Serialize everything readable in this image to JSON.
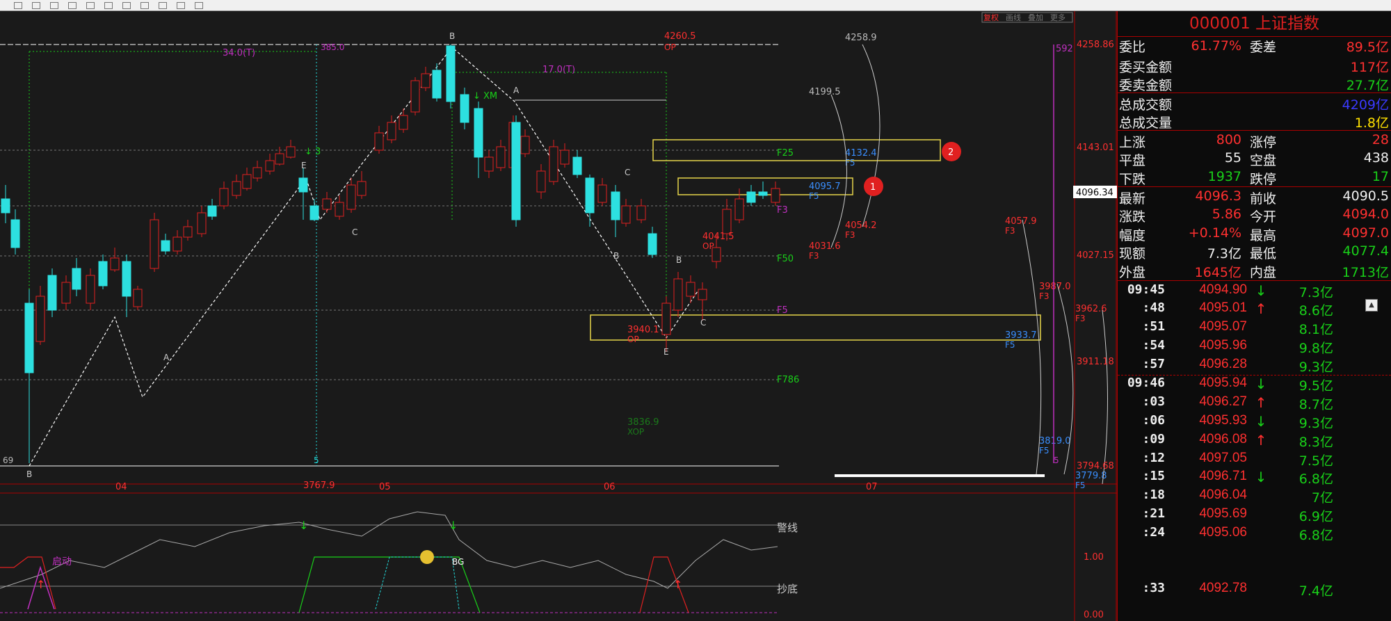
{
  "toolbar": {
    "icons": [
      "scissors-icon",
      "copy-icon",
      "paste-icon",
      "save-icon",
      "rewind-icon",
      "undo-icon",
      "search-icon",
      "cut-icon",
      "refresh-icon",
      "info-icon",
      "close-icon"
    ]
  },
  "chart": {
    "top_buttons": [
      "复权",
      "画线",
      "叠加",
      "更多"
    ],
    "cycle_labels": [
      "34.0(T)",
      "17.0(T)"
    ],
    "price_labels": {
      "p4258_9": "4258.9",
      "p4199_5": "4199.5",
      "p4260_5": "4260.5",
      "op": "OP",
      "p4132": "4132.4",
      "p4095_7": "4095.7",
      "p4054": "4054.2",
      "p4031": "4031.6",
      "p4057_9": "4057.9",
      "p4041_5": "4041.5",
      "p3940": "3940.1",
      "p3987": "3987.0",
      "p3962": "3962.6",
      "p3933": "3933.7",
      "p3836": "3836.9",
      "xop": "XOP",
      "p3819": "3819.0",
      "p3779": "3779.8",
      "p3767": "3767.9",
      "p385": "385.0",
      "f3": "F3",
      "f5": "F5",
      "val592": "592",
      "val5": "5",
      "val69": "69"
    },
    "fib_labels": [
      "F25",
      "F50",
      "F5",
      "F786",
      "F3"
    ],
    "wave_labels": [
      "A",
      "B",
      "C",
      "E",
      "XM"
    ],
    "axis_right": [
      "4258.86",
      "4143.01",
      "4096.34",
      "4027.15",
      "3911.18",
      "3794.68",
      "1.00",
      "0.00"
    ],
    "current_price_tag": "4096.34",
    "months": [
      "04",
      "05",
      "06",
      "07"
    ],
    "markers": [
      "1",
      "2"
    ],
    "indicator_labels": {
      "warn": "警线",
      "bottom": "抄底",
      "start": "启动",
      "bg": "BG"
    }
  },
  "panel": {
    "title": "000001  上证指数",
    "weibi_label": "委比",
    "weibi": "61.77%",
    "weicha_label": "委差",
    "weicha": "89.5亿",
    "buy_amt_label": "委买金额",
    "buy_amt": "117亿",
    "sell_amt_label": "委卖金额",
    "sell_amt": "27.7亿",
    "total_amt_label": "总成交额",
    "total_amt": "4209亿",
    "total_vol_label": "总成交量",
    "total_vol": "1.8亿",
    "up_label": "上涨",
    "up": "800",
    "limit_up_label": "涨停",
    "limit_up": "28",
    "flat_label": "平盘",
    "flat": "55",
    "empty_label": "空盘",
    "empty": "438",
    "down_label": "下跌",
    "down": "1937",
    "limit_down_label": "跌停",
    "limit_down": "17",
    "last_label": "最新",
    "last": "4096.3",
    "prev_label": "前收",
    "prev": "4090.5",
    "chg_label": "涨跌",
    "chg": "5.86",
    "open_label": "今开",
    "open": "4094.0",
    "pct_label": "幅度",
    "pct": "+0.14%",
    "high_label": "最高",
    "high": "4097.0",
    "cur_amt_label": "现额",
    "cur_amt": "7.3亿",
    "low_label": "最低",
    "low": "4077.4",
    "outer_label": "外盘",
    "outer": "1645亿",
    "inner_label": "内盘",
    "inner": "1713亿",
    "ticks": [
      {
        "t": "09:45",
        "p": "4094.90",
        "a": "↓",
        "dir": "down",
        "v": "7.3亿"
      },
      {
        "t": ":48",
        "p": "4095.01",
        "a": "↑",
        "dir": "up",
        "v": "8.6亿"
      },
      {
        "t": ":51",
        "p": "4095.07",
        "a": "",
        "dir": "",
        "v": "8.1亿"
      },
      {
        "t": ":54",
        "p": "4095.96",
        "a": "",
        "dir": "",
        "v": "9.8亿"
      },
      {
        "t": ":57",
        "p": "4096.28",
        "a": "",
        "dir": "",
        "v": "9.3亿"
      },
      {
        "t": "09:46",
        "p": "4095.94",
        "a": "↓",
        "dir": "down",
        "v": "9.5亿"
      },
      {
        "t": ":03",
        "p": "4096.27",
        "a": "↑",
        "dir": "up",
        "v": "8.7亿"
      },
      {
        "t": ":06",
        "p": "4095.93",
        "a": "↓",
        "dir": "down",
        "v": "9.3亿"
      },
      {
        "t": ":09",
        "p": "4096.08",
        "a": "↑",
        "dir": "up",
        "v": "8.3亿"
      },
      {
        "t": ":12",
        "p": "4097.05",
        "a": "",
        "dir": "",
        "v": "7.5亿"
      },
      {
        "t": ":15",
        "p": "4096.71",
        "a": "↓",
        "dir": "down",
        "v": "6.8亿"
      },
      {
        "t": ":18",
        "p": "4096.04",
        "a": "",
        "dir": "",
        "v": "7亿"
      },
      {
        "t": ":21",
        "p": "4095.69",
        "a": "",
        "dir": "",
        "v": "6.9亿"
      },
      {
        "t": ":24",
        "p": "4095.06",
        "a": "",
        "dir": "",
        "v": "6.8亿"
      },
      {
        "t": "",
        "p": "",
        "a": "",
        "dir": "",
        "v": ""
      },
      {
        "t": "",
        "p": "",
        "a": "",
        "dir": "",
        "v": ""
      },
      {
        "t": ":33",
        "p": "4092.78",
        "a": "",
        "dir": "",
        "v": "7.4亿"
      }
    ],
    "scroll_up": "▲"
  },
  "colors": {
    "up": "#ff3030",
    "down": "#19d019",
    "bg": "#1a1a1a",
    "accent": "#ffe000"
  }
}
